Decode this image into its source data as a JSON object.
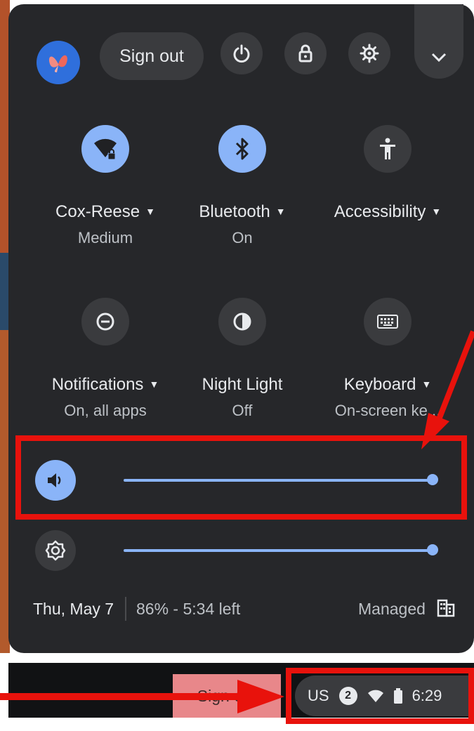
{
  "header": {
    "sign_out_label": "Sign out",
    "icons": [
      "butterfly-avatar-icon",
      "power-icon",
      "lock-icon",
      "gear-icon",
      "chevron-down-icon"
    ]
  },
  "tiles": [
    {
      "label": "Cox-Reese",
      "sub": "Medium",
      "icon": "wifi-lock-icon",
      "active": true
    },
    {
      "label": "Bluetooth",
      "sub": "On",
      "icon": "bluetooth-icon",
      "active": true
    },
    {
      "label": "Accessibility",
      "sub": "",
      "icon": "accessibility-icon",
      "active": false
    },
    {
      "label": "Notifications",
      "sub": "On, all apps",
      "icon": "do-not-disturb-icon",
      "active": false
    },
    {
      "label": "Night Light",
      "sub": "Off",
      "icon": "night-light-icon",
      "active": false
    },
    {
      "label": "Keyboard",
      "sub": "On-screen ke...",
      "icon": "keyboard-icon",
      "active": false
    }
  ],
  "sliders": {
    "volume": {
      "level": 1.0,
      "icon": "volume-icon"
    },
    "brightness": {
      "level": 1.0,
      "icon": "brightness-icon"
    }
  },
  "footer": {
    "date": "Thu, May 7",
    "battery": "86% - 5:34 left",
    "managed": "Managed"
  },
  "shelf": {
    "sign_out_label": "Sign out",
    "ime": "US",
    "notification_count": "2",
    "time": "6:29"
  },
  "colors": {
    "panel_bg": "#26272a",
    "accent": "#8ab4f8",
    "annotation_red": "#e8120c"
  }
}
